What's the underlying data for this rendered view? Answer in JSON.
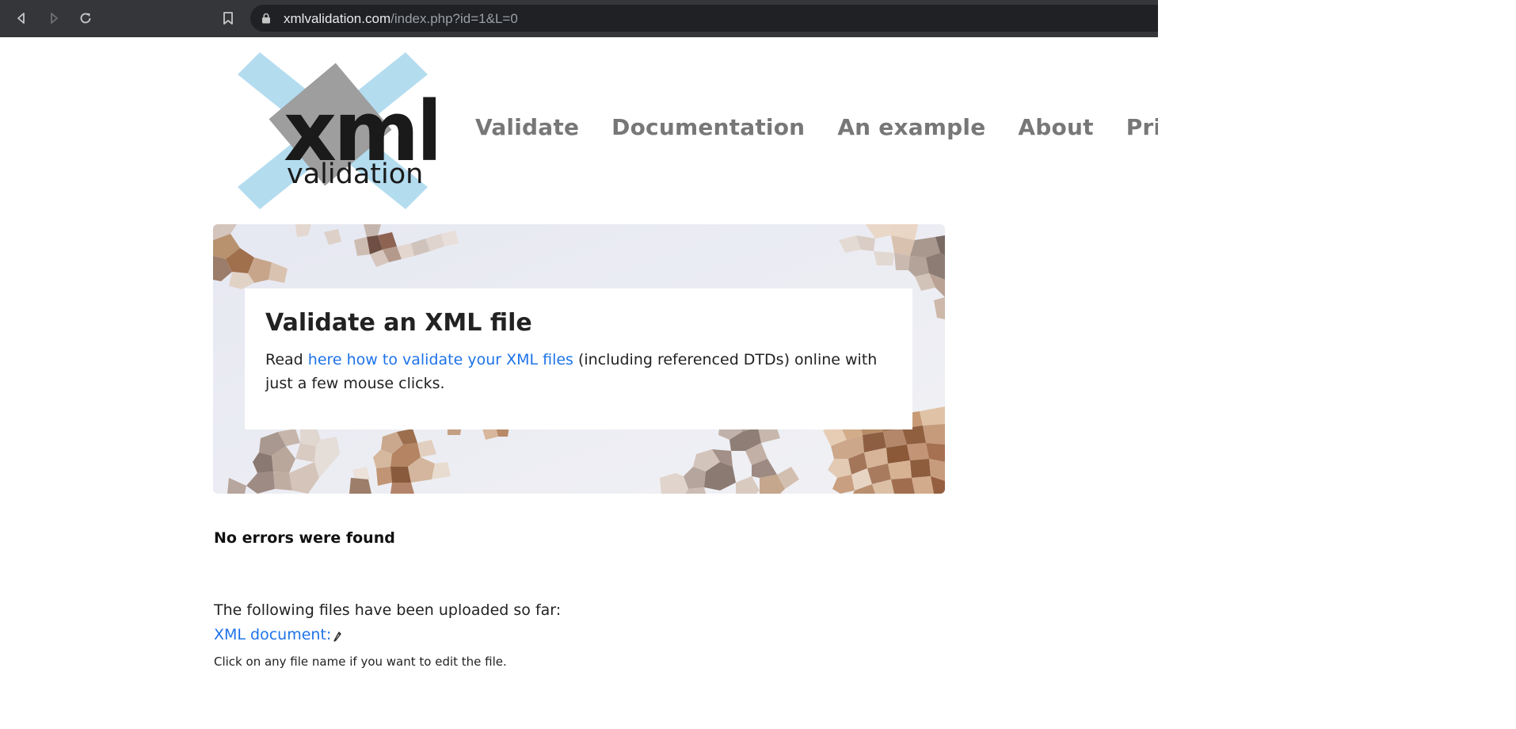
{
  "browser": {
    "url_host": "xmlvalidation.com",
    "url_path": "/index.php?id=1&L=0"
  },
  "logo": {
    "text_main": "xml",
    "text_sub": "validation",
    "colors": {
      "cross": "#b3dcef",
      "square": "#9e9e9e",
      "text": "#1a1a1a"
    }
  },
  "nav": {
    "items": [
      "Validate",
      "Documentation",
      "An example",
      "About",
      "Privacy"
    ]
  },
  "hero": {
    "title": "Validate an XML file",
    "text_before": "Read ",
    "link_text": "here how to validate your XML files",
    "text_after": " (including referenced DTDs) online with just a few mouse clicks."
  },
  "result": {
    "status": "No errors were found",
    "uploaded_label": "The following files have been uploaded so far:",
    "file_link": "XML document:",
    "hint": "Click on any file name if you want to edit the file."
  },
  "colors": {
    "link": "#1e73e8",
    "nav": "#777777",
    "chrome_bg": "#35363a",
    "omnibox_bg": "#202124"
  }
}
